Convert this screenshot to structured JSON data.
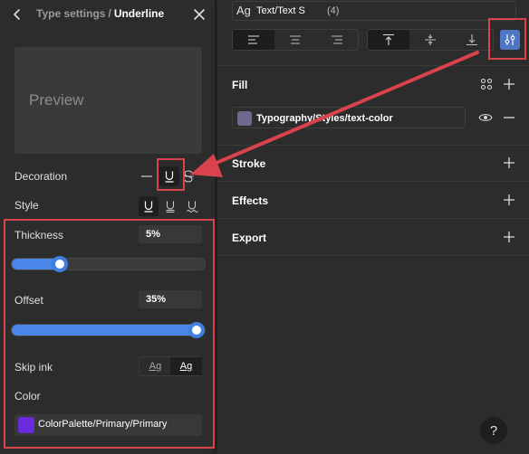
{
  "left_panel": {
    "breadcrumb_parent": "Type settings",
    "breadcrumb_separator": "/",
    "breadcrumb_current": "Underline",
    "preview_text": "Preview",
    "decoration_label": "Decoration",
    "style_label": "Style",
    "thickness_label": "Thickness",
    "thickness_value": "5%",
    "thickness_slider_level": 0.25,
    "offset_label": "Offset",
    "offset_value": "35%",
    "offset_slider_level": 1.0,
    "skip_ink_label": "Skip ink",
    "skip_ink_options": [
      "Ag",
      "Ag"
    ],
    "skip_ink_selected": 1,
    "color_label": "Color",
    "color_value": "ColorPalette/Primary/Primary",
    "color_swatch": "#6a2bdc",
    "decoration_options": [
      "line-none-icon",
      "underline-icon",
      "strikethrough-icon"
    ],
    "decoration_selected": "underline-icon",
    "style_options": [
      "underline-solid-icon",
      "underline-double-icon",
      "underline-wavy-icon"
    ],
    "style_selected": "underline-solid-icon"
  },
  "right_panel": {
    "text_style_icon": "Ag",
    "text_style_name": "Text/Text S",
    "text_style_size": "(4)",
    "fill_title": "Fill",
    "fill_style_name": "Typography/Styles/text-color",
    "fill_swatch": "#6e6a8e",
    "stroke_title": "Stroke",
    "effects_title": "Effects",
    "export_title": "Export",
    "help_label": "?"
  },
  "colors": {
    "accent": "#4a86e8",
    "annotation": "#d9434b",
    "panel_bg": "#2c2c2c"
  }
}
